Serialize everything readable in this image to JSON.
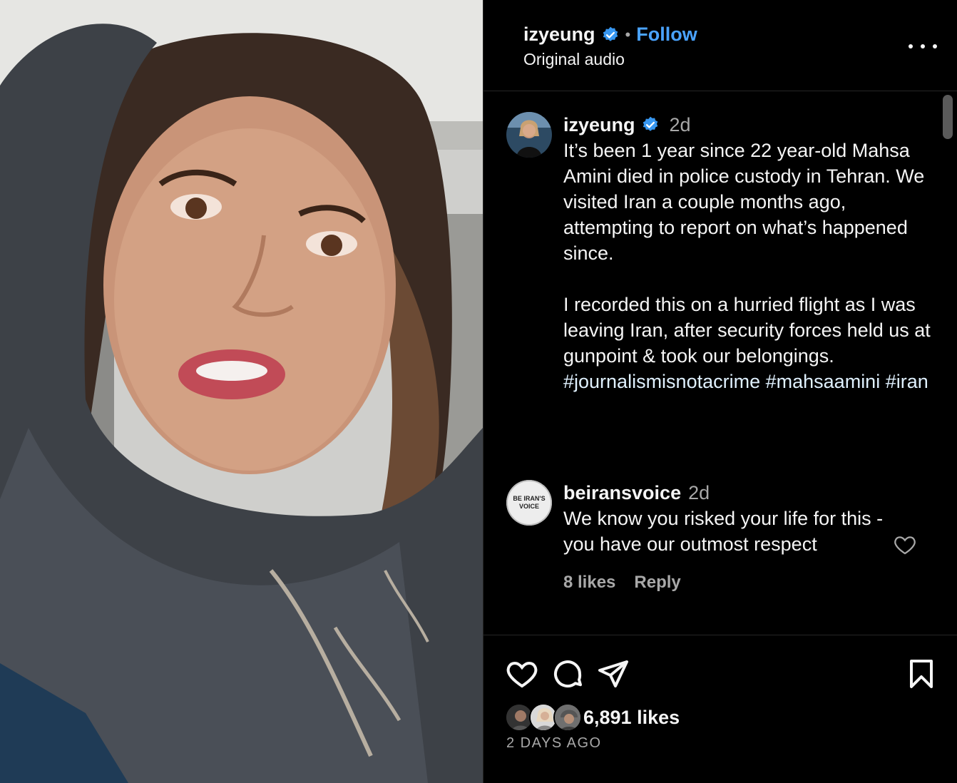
{
  "post": {
    "username": "izyeung",
    "follow_label": "Follow",
    "separator": "•",
    "audio": "Original audio"
  },
  "caption": {
    "username": "izyeung",
    "time": "2d",
    "text_p1": "It’s been 1 year since 22 year-old Mahsa Amini died in police custody in Tehran. We visited Iran a couple months ago, attempting to report on what’s happened since.",
    "text_p2_start": "I recorded this on a hurried flight as I was leaving Iran, after security forces held us at gunpoint & took our belongings. ",
    "hashtag_1": "#journalismisnotacrime",
    "hashtag_2": "#mahsaamini",
    "hashtag_3": "#iran"
  },
  "comment": {
    "username": "beiransvoice",
    "time": "2d",
    "text": "We know you risked your life for this - you have our outmost respect",
    "likes": "8 likes",
    "reply_label": "Reply",
    "avatar_text_1": "BE IRAN'S",
    "avatar_text_2": "VOICE"
  },
  "footer": {
    "likes": "6,891 likes",
    "time_ago": "2 DAYS AGO"
  },
  "icons": {
    "verified": "verified-badge-icon",
    "more": "more-options-icon",
    "like": "heart-icon",
    "comment": "comment-bubble-icon",
    "share": "paper-plane-icon",
    "save": "bookmark-icon"
  },
  "colors": {
    "background": "#000000",
    "accent": "#4aa3ff",
    "verified": "#3897f0",
    "muted": "#a8a8a8"
  }
}
